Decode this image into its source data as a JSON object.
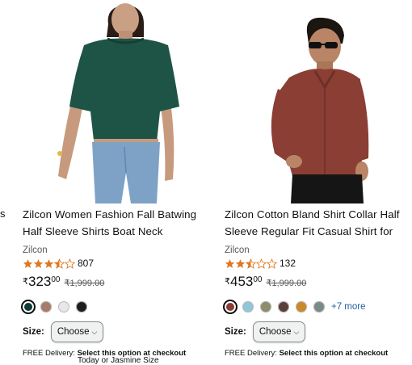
{
  "edge_text": "s",
  "products": [
    {
      "title": "Zilcon Women Fashion Fall Batwing Half Sleeve Shirts Boat Neck Oversize...",
      "brand": "Zilcon",
      "rating": 3.5,
      "review_count": "807",
      "currency": "₹",
      "price_whole": "323",
      "price_fraction": "00",
      "mrp": "₹1,999.00",
      "swatches": [
        {
          "color": "#0F3B33",
          "selected": true
        },
        {
          "color": "#A87A6E",
          "selected": false
        },
        {
          "color": "#E8E6EC",
          "selected": false
        },
        {
          "color": "#1E1E1E",
          "selected": false
        }
      ],
      "more_label": "",
      "size_label": "Size:",
      "choose_label": "Choose",
      "delivery_label": "FREE Delivery:",
      "delivery_value": "Select this option at checkout"
    },
    {
      "title": "Zilcon Cotton Bland Shirt Collar Half Sleeve Regular Fit Casual Shirt for Ma...",
      "brand": "Zilcon",
      "rating": 2.5,
      "review_count": "132",
      "currency": "₹",
      "price_whole": "453",
      "price_fraction": "00",
      "mrp": "₹1,999.00",
      "swatches": [
        {
          "color": "#8A3E34",
          "selected": true
        },
        {
          "color": "#8FC6D8",
          "selected": false
        },
        {
          "color": "#8E8C6C",
          "selected": false
        },
        {
          "color": "#5A3E3A",
          "selected": false
        },
        {
          "color": "#C88A2A",
          "selected": false
        },
        {
          "color": "#7A8A86",
          "selected": false
        }
      ],
      "more_label": "+7 more",
      "size_label": "Size:",
      "choose_label": "Choose",
      "delivery_label": "FREE Delivery:",
      "delivery_value": "Select this option at checkout"
    }
  ],
  "bottom_cut_text": "Today or Jasmine Size",
  "colors": {
    "star": "#DE7921",
    "link": "#2162A1"
  }
}
